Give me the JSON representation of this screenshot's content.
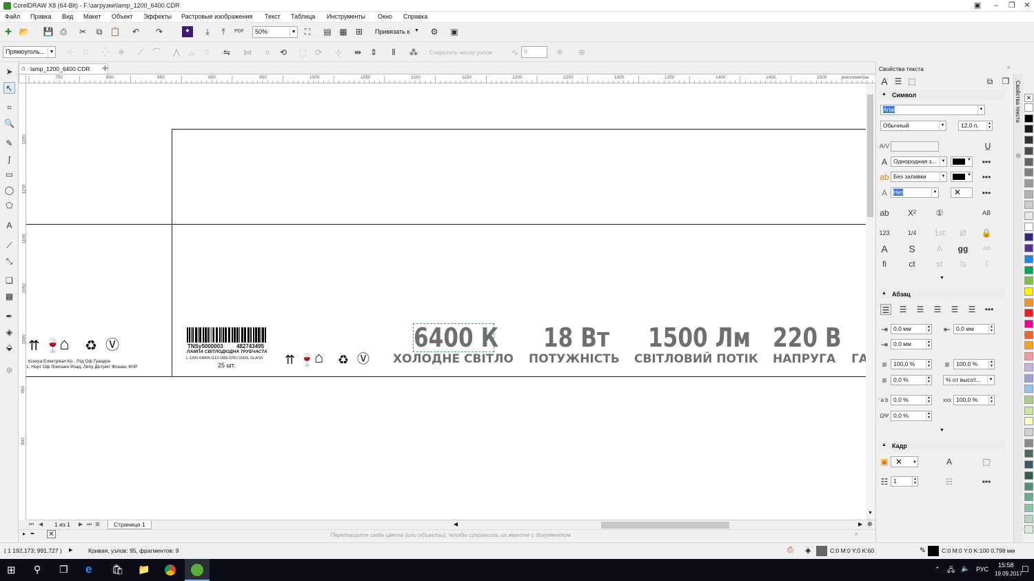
{
  "window": {
    "title": "CorelDRAW X8 (64-Bit) - F:\\загрузки\\lamp_1200_6400.CDR"
  },
  "menu": [
    "Файл",
    "Правка",
    "Вид",
    "Макет",
    "Объект",
    "Эффекты",
    "Растровые изображения",
    "Текст",
    "Таблица",
    "Инструменты",
    "Окно",
    "Справка"
  ],
  "toolbar": {
    "zoom": "50%",
    "snap_label": "Привязать к",
    "pdf_label": "PDF"
  },
  "property_bar": {
    "object_type": "Прямоуголь...",
    "reduce_nodes": "Сократить число узлов",
    "value": "0"
  },
  "document": {
    "tab": "lamp_1200_6400.CDR",
    "page_tab": "Страница 1",
    "page_counter": "1 из 1"
  },
  "ruler": {
    "h_ticks": [
      "750",
      "800",
      "850",
      "900",
      "950",
      "1000",
      "1050",
      "1100",
      "1150",
      "1200",
      "1250",
      "1300",
      "1350",
      "1400",
      "1450",
      "1500"
    ],
    "h_unit": "миллиметры",
    "v_ticks": [
      "1200",
      "1150",
      "1100",
      "1050",
      "1000",
      "950",
      "900"
    ]
  },
  "label": {
    "company_line1": "Хснхуа Електрікал Ко., Лтд Оф Гуандон",
    "company_line2": "1, Норт Оф Лонгшен Роад, Лепу Дістрікт Фошан, КНР",
    "barcode_left": "TNSy5000003",
    "barcode_right": "482743495",
    "product_name": "ЛАМПА СВІТЛОДІОДНА ТРУБЧАСТА",
    "product_code": "L-1200-6400K-G13-18W-220V-1500L GLASS",
    "quantity": "25 шт.",
    "specs": [
      {
        "value": "6400 К",
        "caption": "ХОЛОДНЕ СВІТЛО"
      },
      {
        "value": "18 Вт",
        "caption": "ПОТУЖНІСТЬ"
      },
      {
        "value": "1500 Лм",
        "caption": "СВІТЛОВИЙ ПОТІК"
      },
      {
        "value": "220 В",
        "caption": "НАПРУГА"
      },
      {
        "value": "",
        "caption": "ГА"
      }
    ]
  },
  "color_hint": "Перетащите сюда цвета (или объекты), чтобы сохранить их вместе с документом",
  "status": {
    "coords": "( 1 192,173; 991,727 )",
    "info": "Кривая, узлов: 95, фрагментов: 9",
    "fill": "C:0 M:0 Y:0 K:60",
    "outline": "C:0 M:0 Y:0 K:100  0,798 мм"
  },
  "docker": {
    "title": "Свойства текста",
    "tab_label": "Свойства текста",
    "symbol_section": "Символ",
    "font": "Arial",
    "style": "Обычный",
    "size": "12,0 п.",
    "fill_type": "Однородная з...",
    "bg_fill": "Без заливки",
    "outline": "Нет",
    "paragraph_section": "Абзац",
    "indent_left": "0,0 мм",
    "indent_right": "0,0 мм",
    "indent_first": "0,0 мм",
    "line_spacing": "100,0 %",
    "char_spacing": "100,0 %",
    "before_para": "0,0 %",
    "spacing_unit": "% от высот...",
    "lang_spacing": "0,0 %",
    "word_spacing": "100,0 %",
    "char_shift": "0,0 %",
    "frame_section": "Кадр",
    "columns": "1"
  },
  "taskbar": {
    "time": "15:58",
    "date": "19.09.2017",
    "lang": "РУС"
  },
  "palette": [
    "#ffffff",
    "#000000",
    "#1a1a1a",
    "#333333",
    "#4d4d4d",
    "#666666",
    "#808080",
    "#999999",
    "#b3b3b3",
    "#cccccc",
    "#e6e6e6",
    "#ffffff",
    "#2b2a7e",
    "#5b2e91",
    "#1e88e5",
    "#00a651",
    "#7cc242",
    "#fff200",
    "#f7941d",
    "#ed1c24",
    "#ec008c",
    "#f26522",
    "#f9a11b",
    "#f6989d",
    "#c7b3d9",
    "#a3a0cf",
    "#8fc5e8",
    "#a8d08d",
    "#c8e6a0",
    "#fffac0",
    "#d0d0d0",
    "#8a8a8a",
    "#4a6b55",
    "#3a5a6b",
    "#2f5d50",
    "#4f8f7a",
    "#6fa98c",
    "#8ec3a2",
    "#b2d8bf",
    "#d5ecd9"
  ]
}
